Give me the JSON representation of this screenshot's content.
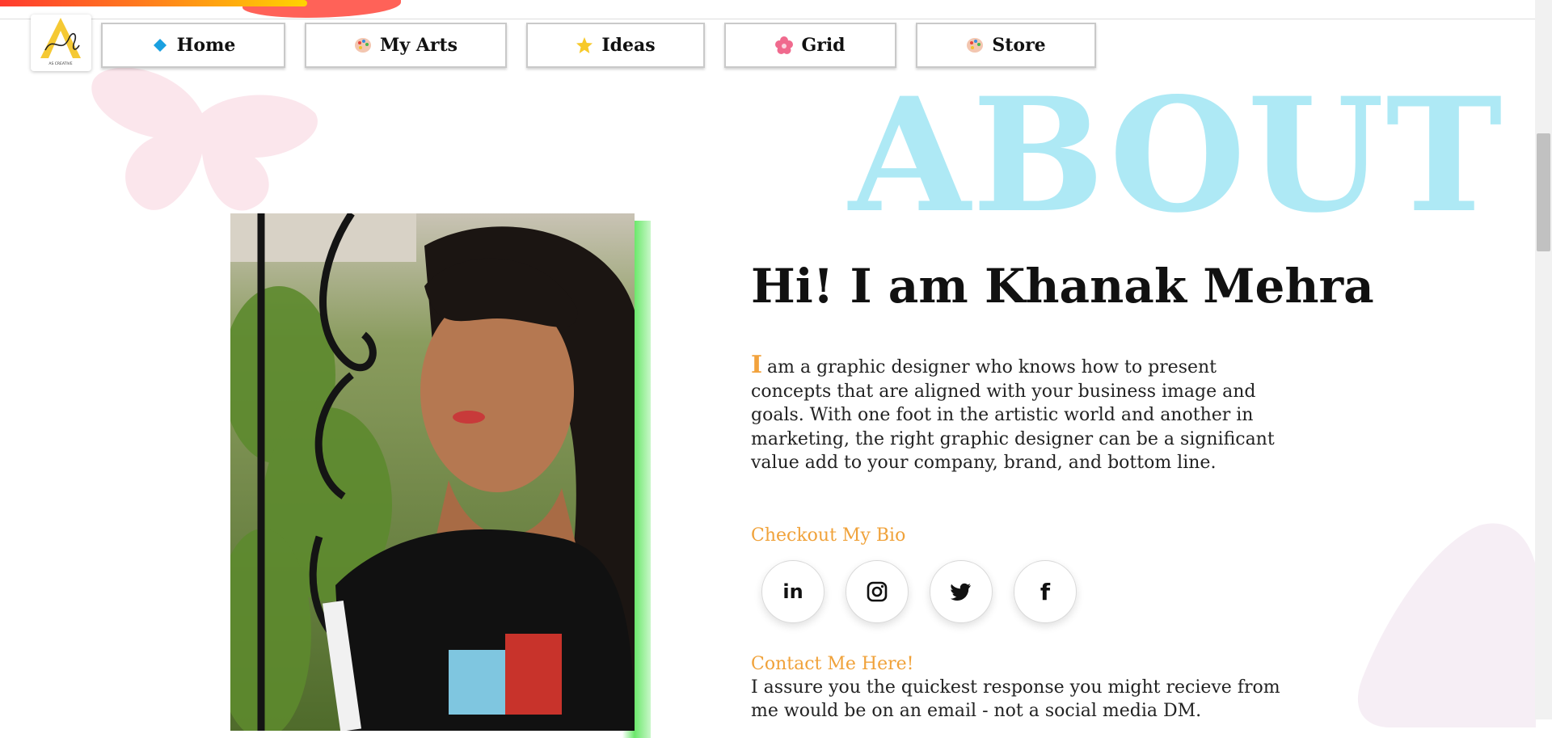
{
  "scroll_progress_fraction": 0.2,
  "logo": {
    "icon": "artful-creative-logo",
    "accent": "#f5c934",
    "text": "Artful AS CREATIVE"
  },
  "nav": {
    "items": [
      {
        "label": "Home",
        "icon": "blue-diamond-icon"
      },
      {
        "label": "My Arts",
        "icon": "palette-icon"
      },
      {
        "label": "Ideas",
        "icon": "star-icon"
      },
      {
        "label": "Grid",
        "icon": "flower-icon"
      },
      {
        "label": "Store",
        "icon": "palette-icon"
      }
    ]
  },
  "about": {
    "heading": "ABOUT",
    "greeting": "Hi! I am Khanak Mehra",
    "bio_dropcap": "I",
    "bio_rest": "am a graphic designer who knows how to present concepts that are aligned with your business image and goals. With one foot in the artistic world and another in marketing, the right graphic designer can be a significant value add to your company, brand, and bottom line.",
    "bio_link_label": "Checkout My Bio",
    "social": [
      {
        "label": "in",
        "icon": "linkedin-icon"
      },
      {
        "label": "",
        "icon": "instagram-icon"
      },
      {
        "label": "",
        "icon": "twitter-icon"
      },
      {
        "label": "f",
        "icon": "facebook-icon"
      }
    ],
    "contact_label": "Contact Me Here!",
    "contact_text": "I assure you the quickest response you might recieve from me would be on an email - not a social media DM."
  },
  "colors": {
    "heading": "#aee9f5",
    "accent": "#f0a23a",
    "photo_edge": "#6be86b"
  }
}
